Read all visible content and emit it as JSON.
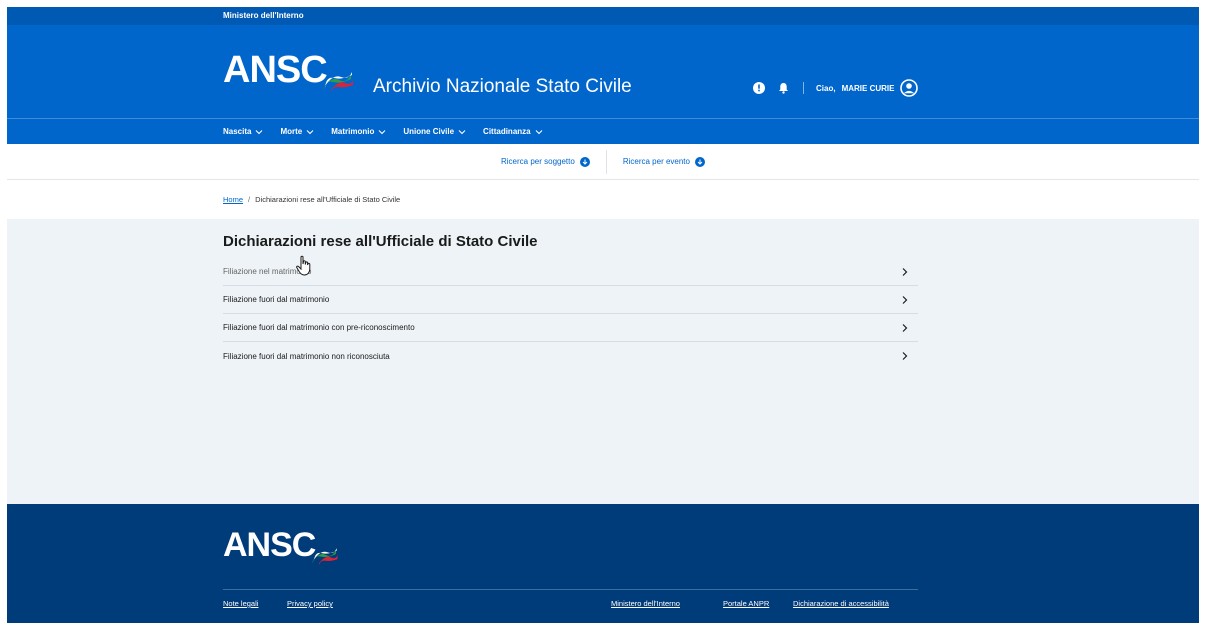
{
  "topbar": {
    "ministry": "Ministero dell'Interno"
  },
  "header": {
    "logo_text": "ANSC",
    "title": "Archivio Nazionale Stato Civile",
    "greeting": "Ciao,",
    "user_name": "MARIE CURIE",
    "icons": [
      "info-icon",
      "bell-icon",
      "user-circle-icon"
    ]
  },
  "nav": {
    "items": [
      {
        "label": "Nascita"
      },
      {
        "label": "Morte"
      },
      {
        "label": "Matrimonio"
      },
      {
        "label": "Unione Civile"
      },
      {
        "label": "Cittadinanza"
      }
    ]
  },
  "search": {
    "by_subject": "Ricerca per soggetto",
    "by_event": "Ricerca per evento"
  },
  "breadcrumb": {
    "home": "Home",
    "separator": "/",
    "current": "Dichiarazioni rese all'Ufficiale di Stato Civile"
  },
  "main": {
    "title": "Dichiarazioni rese all'Ufficiale di Stato Civile",
    "items": [
      {
        "label": "Filiazione nel matrimonio"
      },
      {
        "label": "Filiazione fuori dal matrimonio"
      },
      {
        "label": "Filiazione fuori dal matrimonio con pre-riconoscimento"
      },
      {
        "label": "Filiazione fuori dal matrimonio non riconosciuta"
      }
    ]
  },
  "footer": {
    "logo_text": "ANSC",
    "links": {
      "legal": "Note legali",
      "privacy": "Privacy policy",
      "ministry": "Ministero dell'Interno",
      "anpr": "Portale ANPR",
      "accessibility": "Dichiarazione di accessibilità"
    }
  },
  "colors": {
    "primary": "#0066cc",
    "topbar": "#0059b3",
    "footer": "#003b7a",
    "main_bg": "#eef3f7"
  }
}
